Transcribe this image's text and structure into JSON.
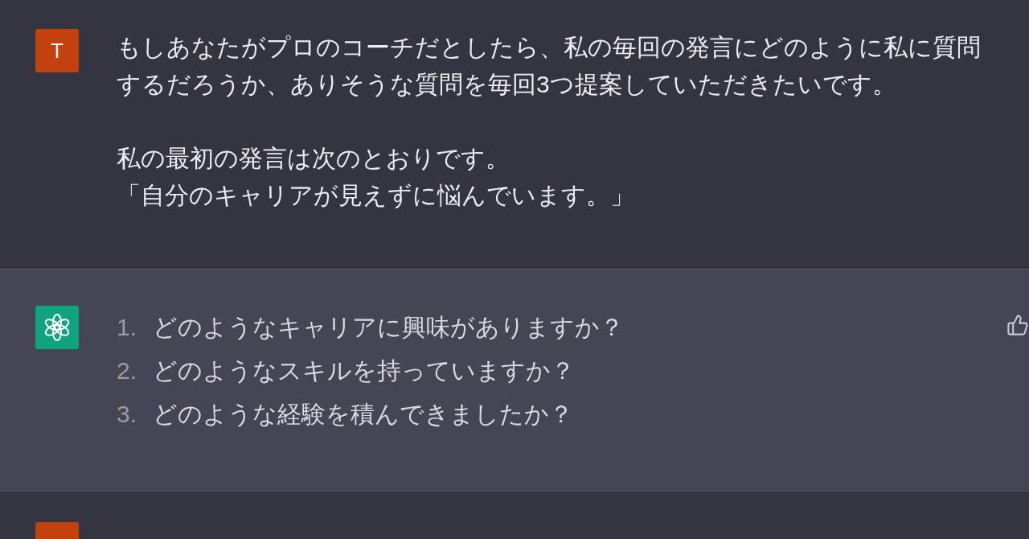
{
  "conversation": [
    {
      "kind": "user",
      "avatar": "T",
      "paragraphs": [
        {
          "lines": [
            "もしあなたがプロのコーチだとしたら、私の毎回の発言にどのように私に質問するだろうか、ありそうな質問を毎回3つ提案していただきたいです。"
          ]
        },
        {
          "lines": [
            "私の最初の発言は次のとおりです。",
            "「自分のキャリアが見えずに悩んでいます。」"
          ]
        }
      ]
    },
    {
      "kind": "assistant",
      "list": [
        {
          "number": "1.",
          "text": "どのようなキャリアに興味がありますか？"
        },
        {
          "number": "2.",
          "text": "どのようなスキルを持っていますか？"
        },
        {
          "number": "3.",
          "text": "どのような経験を積んできましたか？"
        }
      ]
    },
    {
      "kind": "user"
    }
  ]
}
